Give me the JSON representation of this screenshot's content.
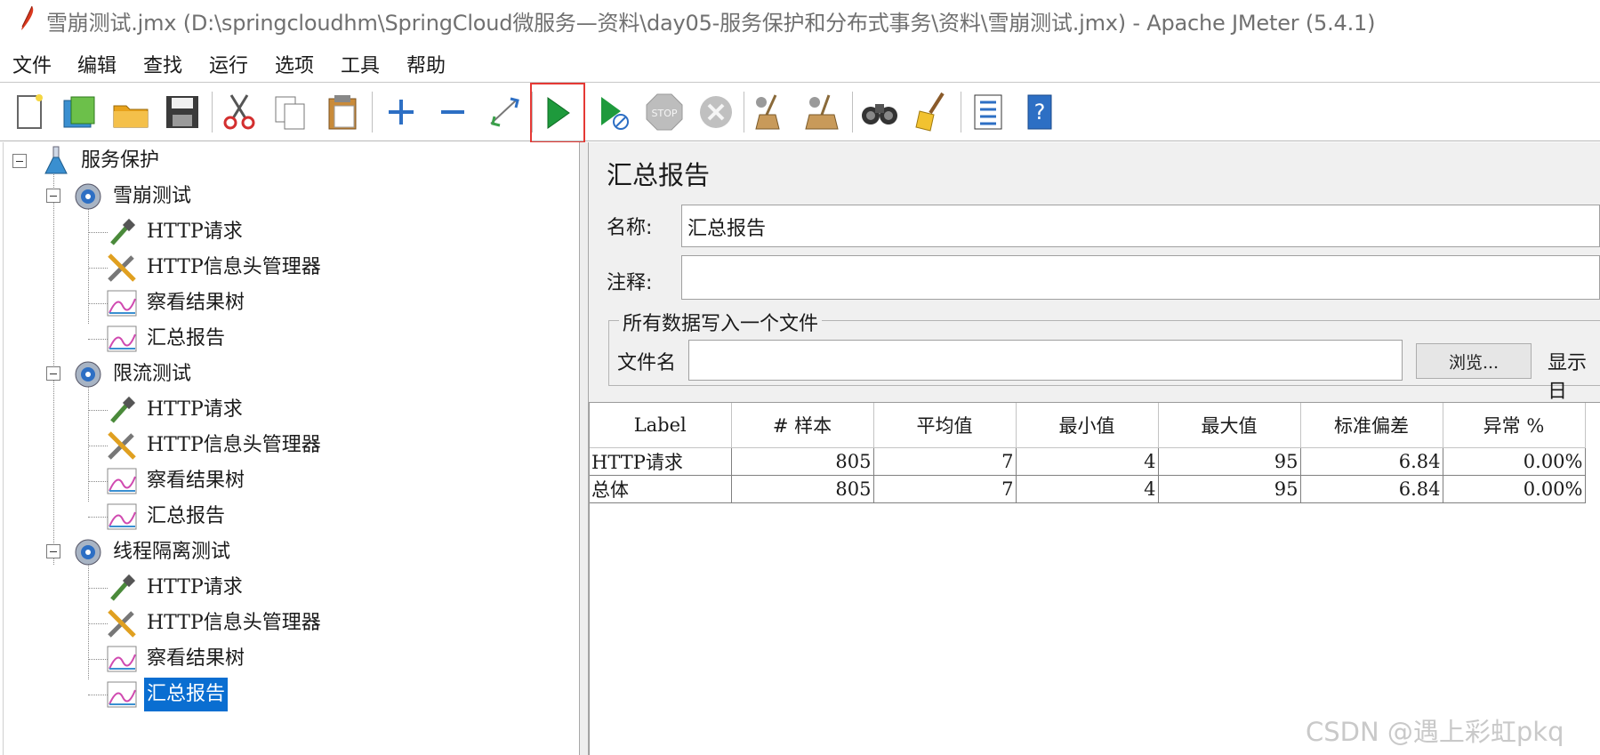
{
  "window": {
    "title": "雪崩测试.jmx (D:\\springcloudhm\\SpringCloud微服务—资料\\day05-服务保护和分布式事务\\资料\\雪崩测试.jmx) - Apache JMeter (5.4.1)"
  },
  "menu": [
    "文件",
    "编辑",
    "查找",
    "运行",
    "选项",
    "工具",
    "帮助"
  ],
  "toolbar": {
    "icons": [
      "new-icon",
      "templates-icon",
      "open-icon",
      "save-icon",
      "cut-icon",
      "copy-icon",
      "paste-icon",
      "expand-icon",
      "collapse-icon",
      "toggle-icon",
      "start-icon",
      "start-no-pauses-icon",
      "stop-icon",
      "shutdown-icon",
      "clear-icon",
      "clear-all-icon",
      "search-icon",
      "reset-search-icon",
      "function-helper-icon",
      "help-icon"
    ],
    "highlight_color": "#e53935"
  },
  "tree": {
    "root": "服务保护",
    "groups": [
      {
        "label": "雪崩测试",
        "children": [
          "HTTP请求",
          "HTTP信息头管理器",
          "察看结果树",
          "汇总报告"
        ]
      },
      {
        "label": "限流测试",
        "children": [
          "HTTP请求",
          "HTTP信息头管理器",
          "察看结果树",
          "汇总报告"
        ]
      },
      {
        "label": "线程隔离测试",
        "children": [
          "HTTP请求",
          "HTTP信息头管理器",
          "察看结果树",
          "汇总报告"
        ]
      }
    ],
    "selected_color": "#0a6ed1"
  },
  "panel": {
    "title": "汇总报告",
    "name_label": "名称:",
    "name_value": "汇总报告",
    "comment_label": "注释:",
    "comment_value": "",
    "fieldset_legend": "所有数据写入一个文件",
    "filename_label": "文件名",
    "filename_value": "",
    "browse_button": "浏览...",
    "display_label": "显示日"
  },
  "table": {
    "headers": [
      "Label",
      "# 样本",
      "平均值",
      "最小值",
      "最大值",
      "标准偏差",
      "异常 %"
    ],
    "rows": [
      [
        "HTTP请求",
        "805",
        "7",
        "4",
        "95",
        "6.84",
        "0.00%"
      ],
      [
        "总体",
        "805",
        "7",
        "4",
        "95",
        "6.84",
        "0.00%"
      ]
    ]
  },
  "watermark": "CSDN @遇上彩虹pkq"
}
